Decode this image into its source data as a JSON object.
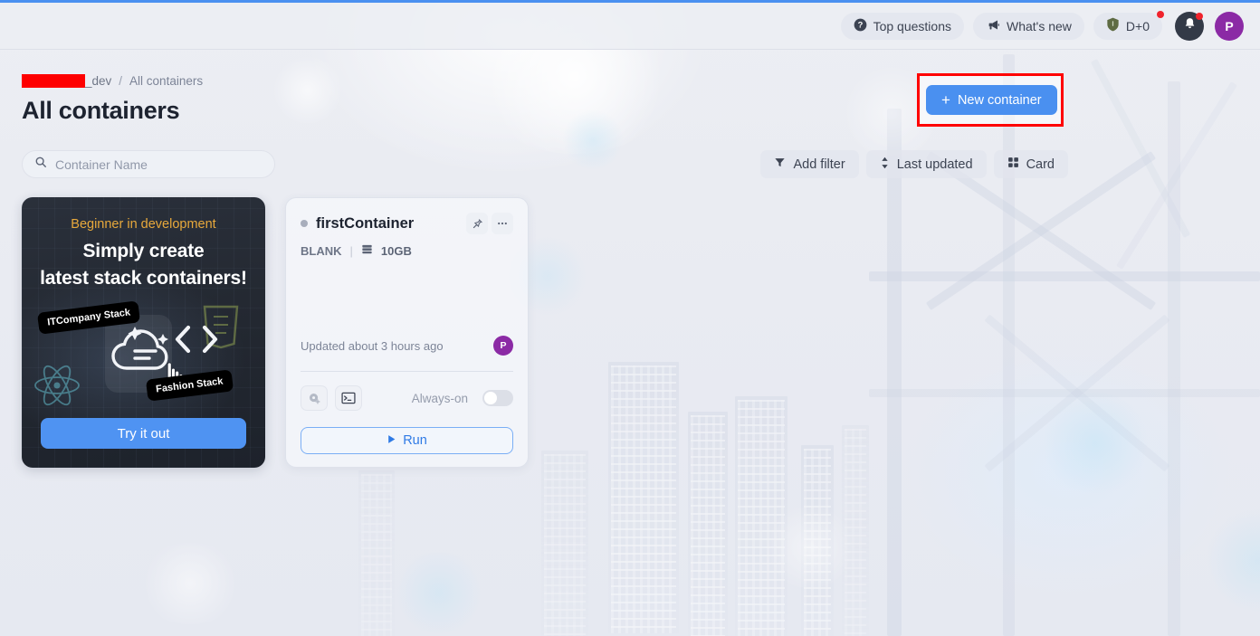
{
  "header": {
    "top_questions": {
      "label": "Top questions",
      "icon": "question-circle-icon"
    },
    "whats_new": {
      "label": "What's new",
      "icon": "megaphone-icon"
    },
    "shield_badge": {
      "label": "D+0",
      "icon": "shield-icon"
    },
    "notifications": {
      "icon": "bell-icon"
    },
    "avatar": {
      "initial": "P"
    }
  },
  "breadcrumb": {
    "org_suffix": "_dev",
    "separator": "/",
    "current": "All containers"
  },
  "page_title": "All containers",
  "primary_action": {
    "label": "New container",
    "plus": "+",
    "accent_color": "#4a90f0",
    "annotation_color": "#ff0000"
  },
  "toolbar": {
    "search_placeholder": "Container Name",
    "search_value": "",
    "search_icon": "search-icon",
    "add_filter": {
      "label": "Add filter",
      "icon": "filter-icon"
    },
    "sort": {
      "label": "Last updated",
      "icon": "sort-icon"
    },
    "view": {
      "label": "Card",
      "icon": "grid-icon"
    }
  },
  "promo": {
    "kicker": "Beginner in development",
    "line1": "Simply create",
    "line2": "latest stack containers!",
    "tag_left": "ITCompany Stack",
    "tag_right": "Fashion Stack",
    "cta": "Try it out",
    "kicker_color": "#e8a93c",
    "cta_color": "#4f93f2"
  },
  "containers": [
    {
      "name": "firstContainer",
      "status": "stopped",
      "template": "BLANK",
      "separator": "|",
      "size": "10GB",
      "updated": "Updated about 3 hours ago",
      "owner_initial": "P",
      "always_on_label": "Always-on",
      "always_on": false,
      "run_label": "Run",
      "pin_icon": "pin-icon",
      "more_icon": "ellipsis-icon",
      "snapshot_icon": "snapshot-add-icon",
      "terminal_icon": "terminal-icon",
      "storage_icon": "storage-icon"
    }
  ]
}
